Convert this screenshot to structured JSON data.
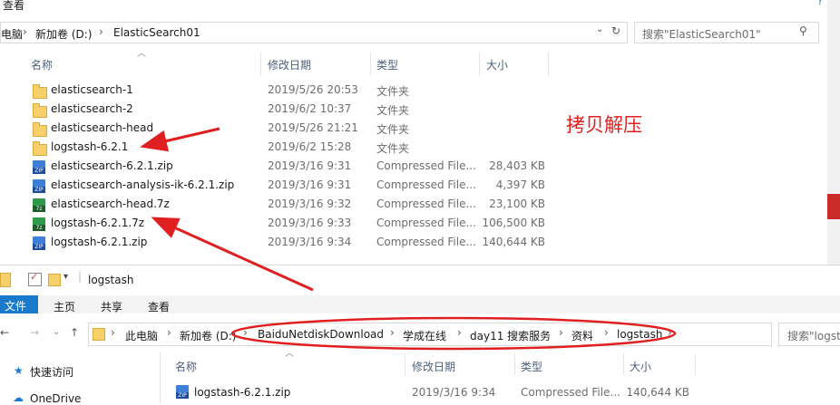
{
  "top": {
    "menu_label": "查看",
    "breadcrumb": [
      "电脑",
      "新加卷 (D:)",
      "ElasticSearch01"
    ],
    "search_placeholder": "搜索\"ElasticSearch01\"",
    "columns": {
      "name": "名称",
      "date": "修改日期",
      "type": "类型",
      "size": "大小"
    },
    "rows": [
      {
        "name": "elasticsearch-1",
        "date": "2019/5/26 20:53",
        "type": "文件夹",
        "size": "",
        "icon": "folder-icon"
      },
      {
        "name": "elasticsearch-2",
        "date": "2019/6/2 10:37",
        "type": "文件夹",
        "size": "",
        "icon": "folder-icon"
      },
      {
        "name": "elasticsearch-head",
        "date": "2019/5/26 21:21",
        "type": "文件夹",
        "size": "",
        "icon": "folder-icon"
      },
      {
        "name": "logstash-6.2.1",
        "date": "2019/6/2 15:28",
        "type": "文件夹",
        "size": "",
        "icon": "folder-icon"
      },
      {
        "name": "elasticsearch-6.2.1.zip",
        "date": "2019/3/16 9:31",
        "type": "Compressed File...",
        "size": "28,403 KB",
        "icon": "zip-icon"
      },
      {
        "name": "elasticsearch-analysis-ik-6.2.1.zip",
        "date": "2019/3/16 9:31",
        "type": "Compressed File...",
        "size": "4,397 KB",
        "icon": "zip-icon"
      },
      {
        "name": "elasticsearch-head.7z",
        "date": "2019/3/16 9:32",
        "type": "Compressed File...",
        "size": "23,100 KB",
        "icon": "7z-icon"
      },
      {
        "name": "logstash-6.2.1.7z",
        "date": "2019/3/16 9:33",
        "type": "Compressed File...",
        "size": "106,500 KB",
        "icon": "7z-icon"
      },
      {
        "name": "logstash-6.2.1.zip",
        "date": "2019/3/16 9:34",
        "type": "Compressed File...",
        "size": "140,644 KB",
        "icon": "zip-icon"
      }
    ],
    "annotation": "拷贝解压"
  },
  "bottom": {
    "window_title": "logstash",
    "ribbon_tabs": [
      "文件",
      "主页",
      "共享",
      "查看"
    ],
    "breadcrumb": [
      "此电脑",
      "新加卷 (D:)",
      "BaiduNetdiskDownload",
      "学成在线",
      "day11 搜索服务",
      "资料",
      "logstash"
    ],
    "search_placeholder": "搜索\"logst",
    "nav_items": [
      "快速访问",
      "OneDrive"
    ],
    "columns": {
      "name": "名称",
      "date": "修改日期",
      "type": "类型",
      "size": "大小"
    },
    "rows": [
      {
        "name": "logstash-6.2.1.zip",
        "date": "2019/3/16 9:34",
        "type": "Compressed File...",
        "size": "140,644 KB",
        "icon": "zip-icon"
      }
    ]
  },
  "colors": {
    "annotation_red": "#e02020",
    "ribbon_file_blue": "#1979ca"
  }
}
